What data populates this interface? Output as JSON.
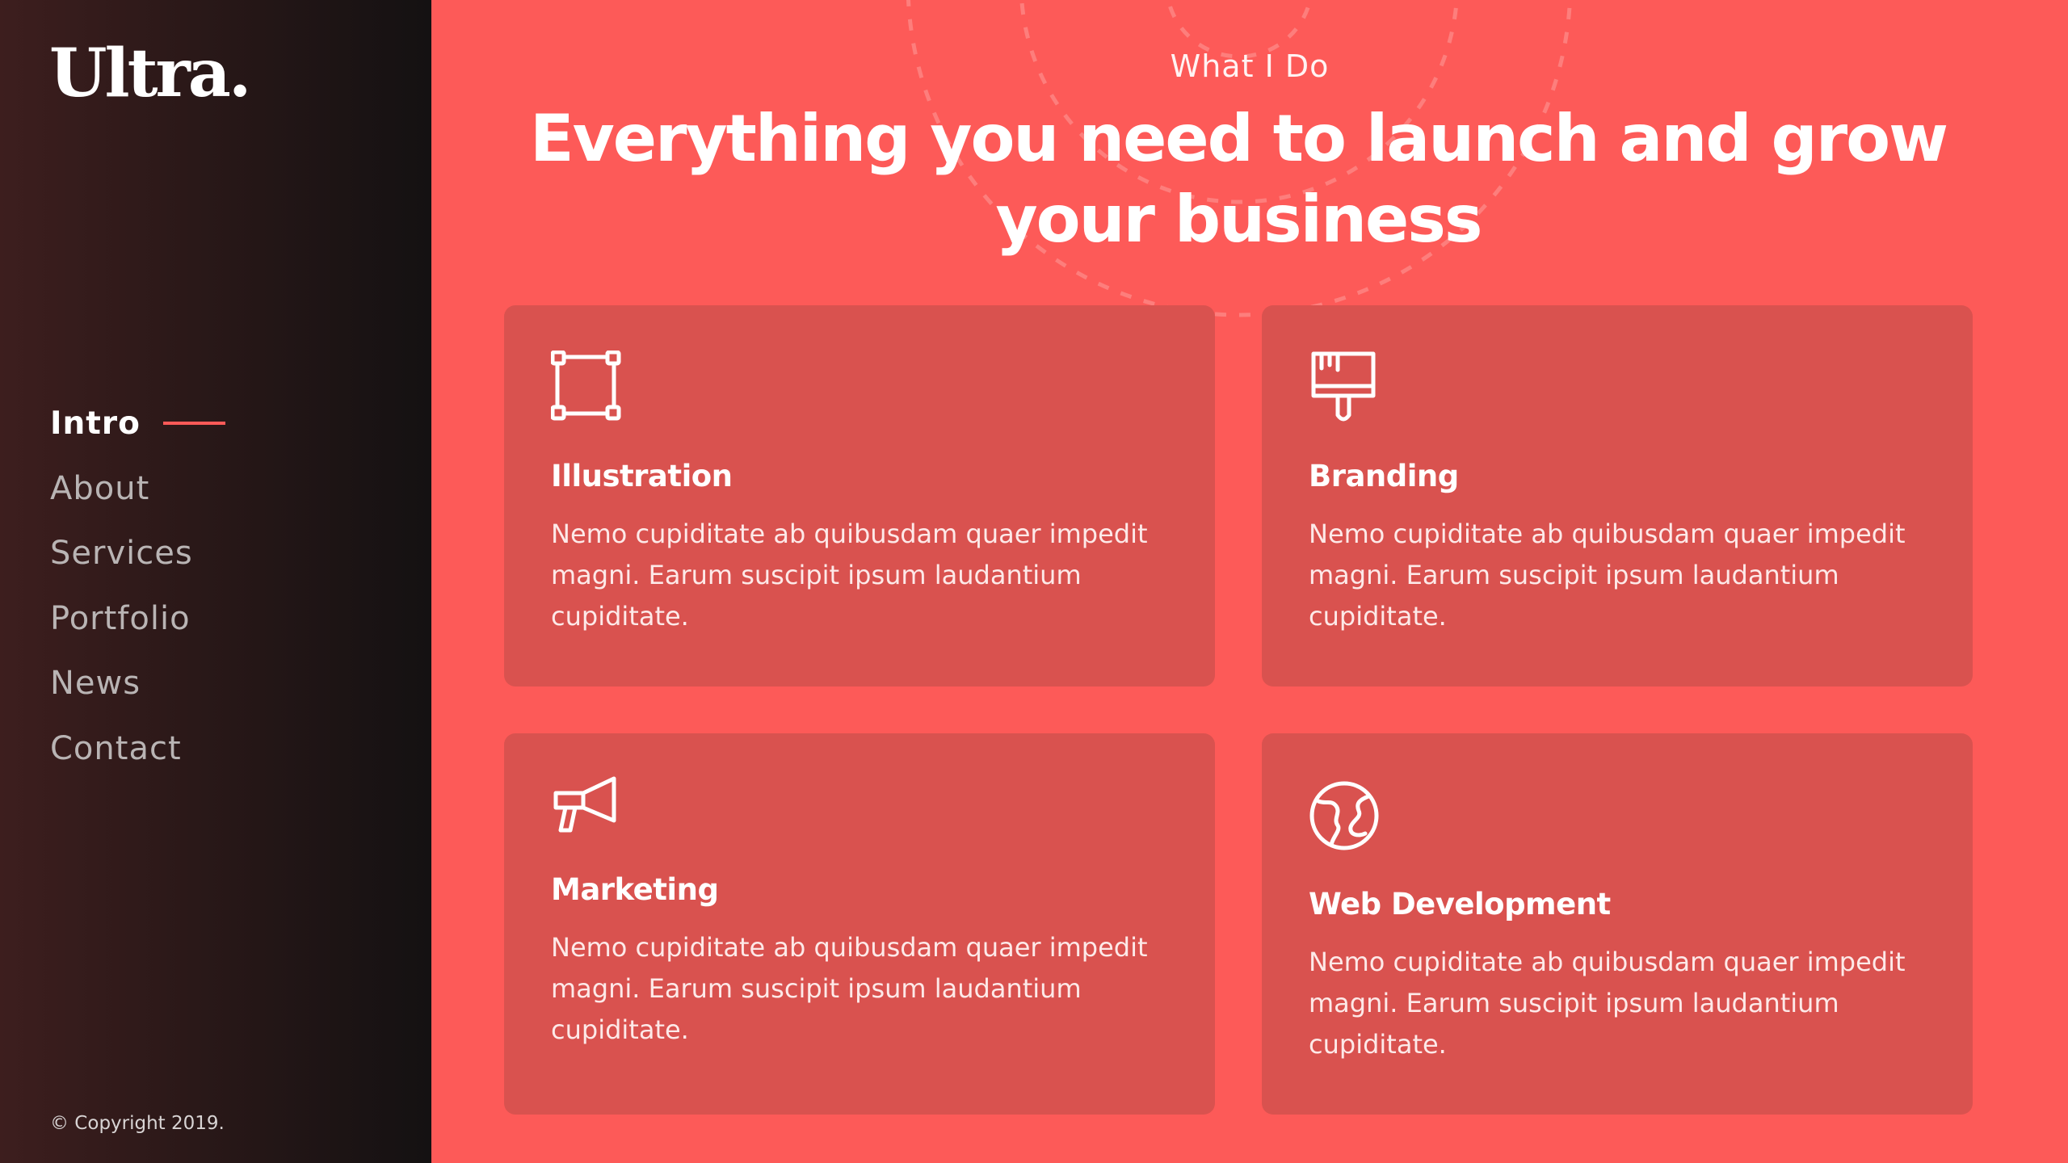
{
  "brand": {
    "logo_text": "Ultra."
  },
  "nav": {
    "items": [
      {
        "label": "Intro",
        "active": true
      },
      {
        "label": "About",
        "active": false
      },
      {
        "label": "Services",
        "active": false
      },
      {
        "label": "Portfolio",
        "active": false
      },
      {
        "label": "News",
        "active": false
      },
      {
        "label": "Contact",
        "active": false
      }
    ]
  },
  "footer": {
    "copyright": "© Copyright 2019."
  },
  "section": {
    "eyebrow": "What I Do",
    "headline": "Everything you need to launch and grow your business"
  },
  "services": [
    {
      "icon": "vector-square-icon",
      "title": "Illustration",
      "text": "Nemo cupiditate ab quibusdam quaer impedit magni. Earum suscipit ipsum laudantium cupiditate."
    },
    {
      "icon": "paint-brush-icon",
      "title": "Branding",
      "text": "Nemo cupiditate ab quibusdam quaer impedit magni. Earum suscipit ipsum laudantium cupiditate."
    },
    {
      "icon": "megaphone-icon",
      "title": "Marketing",
      "text": "Nemo cupiditate ab quibusdam quaer impedit magni. Earum suscipit ipsum laudantium cupiditate."
    },
    {
      "icon": "globe-icon",
      "title": "Web Development",
      "text": "Nemo cupiditate ab quibusdam quaer impedit magni. Earum suscipit ipsum laudantium cupiditate."
    }
  ],
  "colors": {
    "accent": "#fd5a58",
    "card": "#d9524f",
    "sidebar_dark": "#141112",
    "sidebar_warm": "#3d1e1e"
  }
}
